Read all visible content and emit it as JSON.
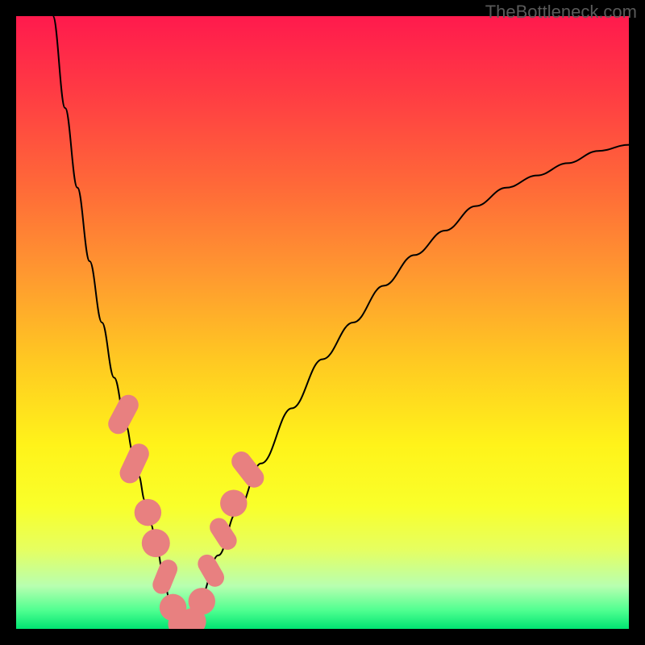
{
  "watermark": "TheBottleneck.com",
  "chart_data": {
    "type": "line",
    "title": "",
    "xlabel": "",
    "ylabel": "",
    "xlim": [
      0,
      100
    ],
    "ylim": [
      0,
      100
    ],
    "grid": false,
    "series": [
      {
        "name": "left-curve",
        "x": [
          6,
          8,
          10,
          12,
          14,
          16,
          18,
          19,
          20,
          21,
          22,
          23,
          24,
          25,
          26,
          27
        ],
        "y": [
          100,
          85,
          72,
          60,
          50,
          41,
          33,
          29,
          25,
          21,
          17,
          13,
          9,
          5,
          2,
          0
        ]
      },
      {
        "name": "right-curve",
        "x": [
          28,
          30,
          33,
          36,
          40,
          45,
          50,
          55,
          60,
          65,
          70,
          75,
          80,
          85,
          90,
          95,
          100
        ],
        "y": [
          0,
          5,
          12,
          19,
          27,
          36,
          44,
          50,
          56,
          61,
          65,
          69,
          72,
          74,
          76,
          78,
          79
        ]
      }
    ],
    "markers": {
      "name": "data-points",
      "color": "#e88080",
      "points": [
        {
          "x": 17.5,
          "y": 35,
          "shape": "pill",
          "w": 3.3,
          "h": 6.8,
          "rot": 28
        },
        {
          "x": 19.3,
          "y": 27,
          "shape": "pill",
          "w": 3.3,
          "h": 6.8,
          "rot": 25
        },
        {
          "x": 21.5,
          "y": 19,
          "shape": "circle",
          "r": 2.2
        },
        {
          "x": 22.8,
          "y": 14,
          "shape": "circle",
          "r": 2.3
        },
        {
          "x": 24.3,
          "y": 8.5,
          "shape": "pill",
          "w": 3.0,
          "h": 5.8,
          "rot": 22
        },
        {
          "x": 25.6,
          "y": 3.5,
          "shape": "circle",
          "r": 2.2
        },
        {
          "x": 27.0,
          "y": 0.8,
          "shape": "circle",
          "r": 2.2
        },
        {
          "x": 28.8,
          "y": 1.2,
          "shape": "circle",
          "r": 2.2
        },
        {
          "x": 30.3,
          "y": 4.5,
          "shape": "circle",
          "r": 2.2
        },
        {
          "x": 31.8,
          "y": 9.5,
          "shape": "pill",
          "w": 3.0,
          "h": 5.6,
          "rot": -30
        },
        {
          "x": 33.8,
          "y": 15.5,
          "shape": "pill",
          "w": 3.0,
          "h": 5.6,
          "rot": -33
        },
        {
          "x": 35.5,
          "y": 20.5,
          "shape": "circle",
          "r": 2.2
        },
        {
          "x": 37.8,
          "y": 26.0,
          "shape": "pill",
          "w": 3.2,
          "h": 6.6,
          "rot": -38
        }
      ]
    },
    "gradient_axis": {
      "orientation": "vertical",
      "top_color": "#ff1a4d",
      "bottom_color": "#00e472"
    }
  }
}
